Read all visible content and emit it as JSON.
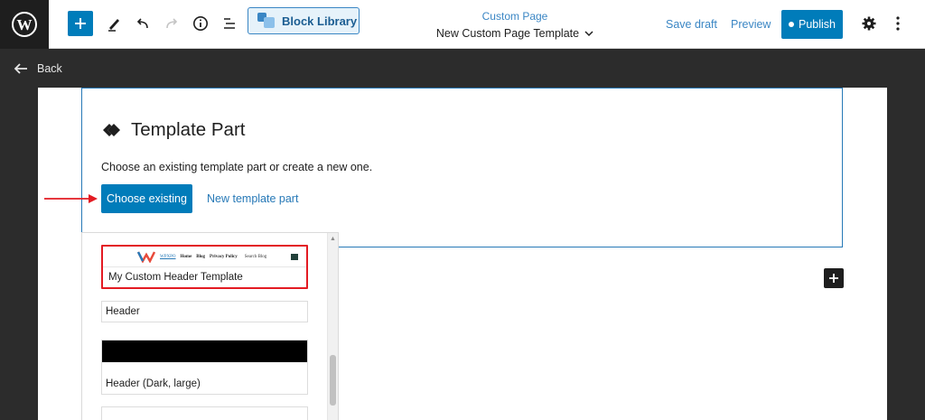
{
  "toolbar": {
    "block_library_label": "Block Library",
    "document_type": "Custom Page",
    "document_name": "New Custom Page Template",
    "save_draft_label": "Save draft",
    "preview_label": "Preview",
    "publish_label": "Publish"
  },
  "back_label": "Back",
  "block": {
    "title": "Template Part",
    "description": "Choose an existing template part or create a new one.",
    "choose_existing_label": "Choose existing",
    "new_template_part_label": "New template part"
  },
  "template_parts": [
    {
      "label": "My Custom Header Template",
      "highlighted": true,
      "preview": {
        "logo_text": "WPXPO",
        "nav_links": [
          "Home",
          "Blog",
          "Privacy Policy"
        ],
        "search_text": "Search Blog"
      }
    },
    {
      "label": "Header"
    },
    {
      "label": "Header (Dark, large)"
    }
  ],
  "colors": {
    "accent": "#007cba",
    "highlight": "#e31b23",
    "dark_bg": "#2c2c2c"
  },
  "icons": {
    "wordpress": "wordpress-logo-icon",
    "add": "plus-icon",
    "tools": "pen-icon",
    "undo": "undo-icon",
    "redo": "redo-icon",
    "details": "info-icon",
    "list_view": "list-view-icon",
    "settings": "gear-icon",
    "options": "vertical-ellipsis-icon",
    "back": "arrow-left-icon",
    "template_part": "template-part-icon"
  }
}
